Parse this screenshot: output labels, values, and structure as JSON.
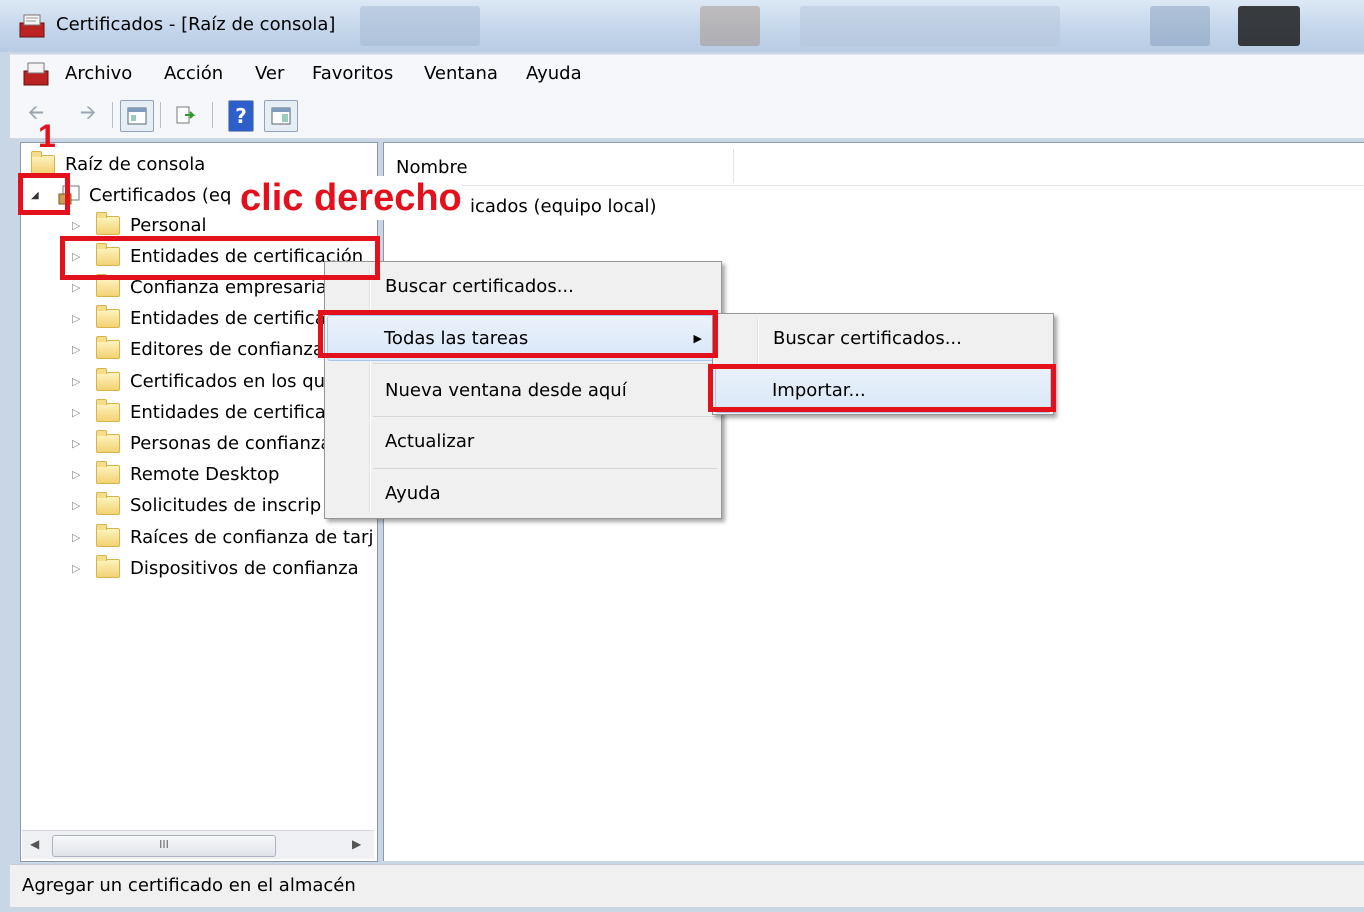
{
  "window": {
    "title": "Certificados - [Raíz de consola]"
  },
  "menubar": [
    "Archivo",
    "Acción",
    "Ver",
    "Favoritos",
    "Ventana",
    "Ayuda"
  ],
  "tree": {
    "root": "Raíz de consola",
    "certs": "Certificados (eq",
    "items": [
      "Personal",
      "Entidades de certificación",
      "Confianza empresarial",
      "Entidades de certificación",
      "Editores de confianza",
      "Certificados en los qu",
      "Entidades de certificación",
      "Personas de confianza",
      "Remote Desktop",
      "Solicitudes de inscrip",
      "Raíces de confianza de tarj",
      "Dispositivos de confianza"
    ]
  },
  "right_pane": {
    "column_header": "Nombre",
    "row": "icados (equipo local)"
  },
  "context_menu": {
    "items": [
      "Buscar certificados...",
      "Todas las tareas",
      "Nueva ventana desde aquí",
      "Actualizar",
      "Ayuda"
    ]
  },
  "submenu": {
    "items": [
      "Buscar certificados...",
      "Importar..."
    ]
  },
  "status_bar": {
    "text": "Agregar un certificado en el almacén"
  },
  "annotations": {
    "step": "1",
    "right_click": "clic derecho",
    "color": "#e3111c"
  },
  "scrollbar": {
    "thumb_glyph": "III"
  }
}
